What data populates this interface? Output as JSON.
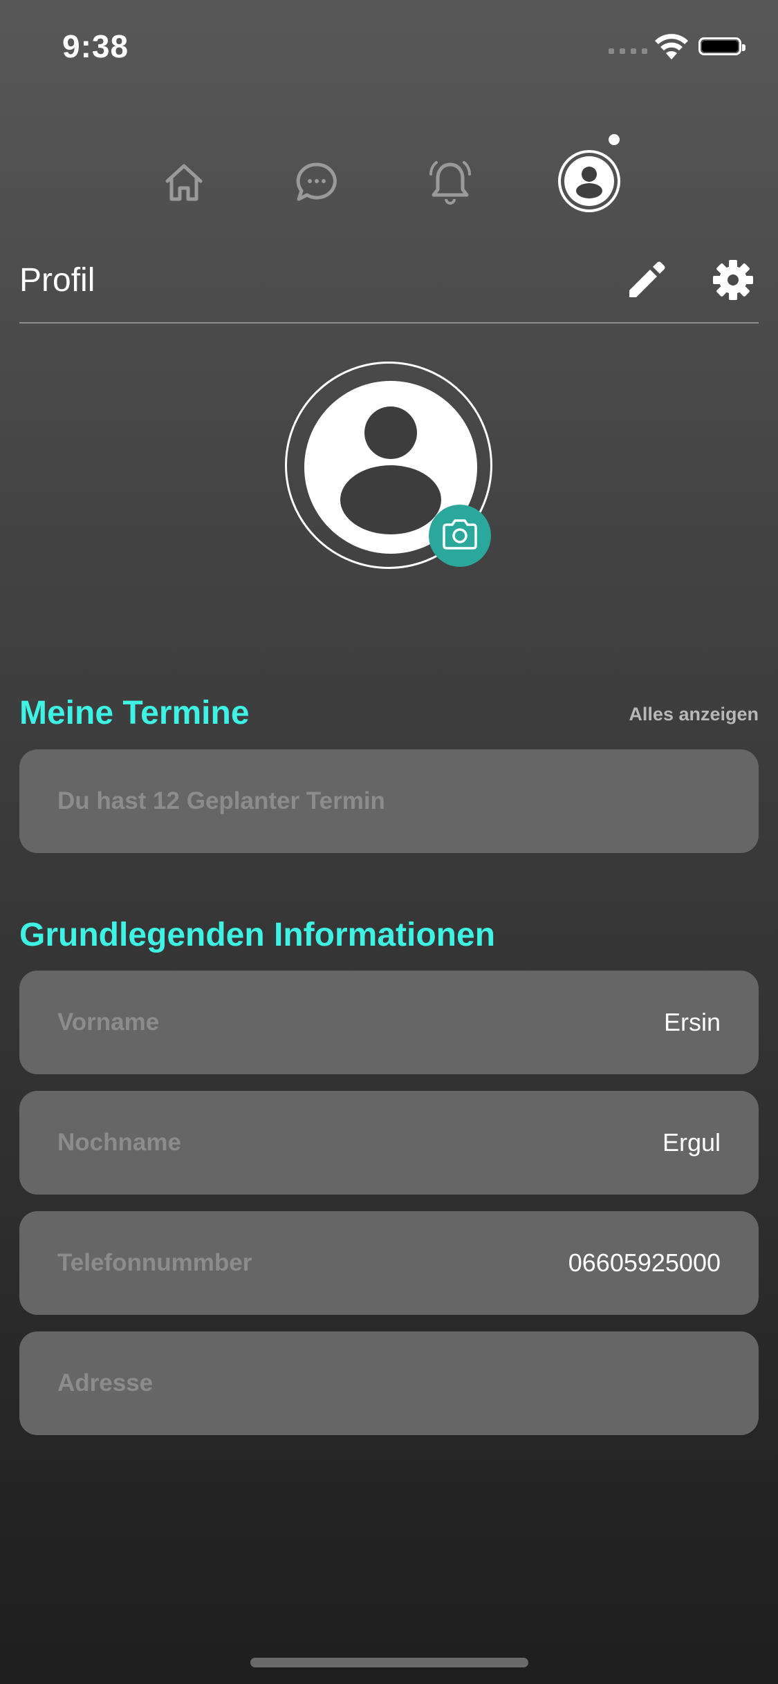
{
  "status_bar": {
    "time": "9:38"
  },
  "nav": {
    "items": [
      {
        "icon": "home-icon",
        "active": false
      },
      {
        "icon": "chat-icon",
        "active": false
      },
      {
        "icon": "bell-icon",
        "active": false
      },
      {
        "icon": "profile-icon",
        "active": true
      }
    ]
  },
  "header": {
    "title": "Profil"
  },
  "appointments": {
    "title": "Meine Termine",
    "show_all": "Alles anzeigen",
    "summary": "Du hast 12 Geplanter Termin"
  },
  "basic_info": {
    "title": "Grundlegenden Informationen",
    "fields": [
      {
        "label": "Vorname",
        "value": "Ersin"
      },
      {
        "label": "Nochname",
        "value": "Ergul"
      },
      {
        "label": "Telefonnummber",
        "value": "06605925000"
      },
      {
        "label": "Adresse",
        "value": ""
      }
    ]
  },
  "colors": {
    "accent": "#3ef2e4",
    "camera": "#2aa89c",
    "card": "#666666"
  }
}
